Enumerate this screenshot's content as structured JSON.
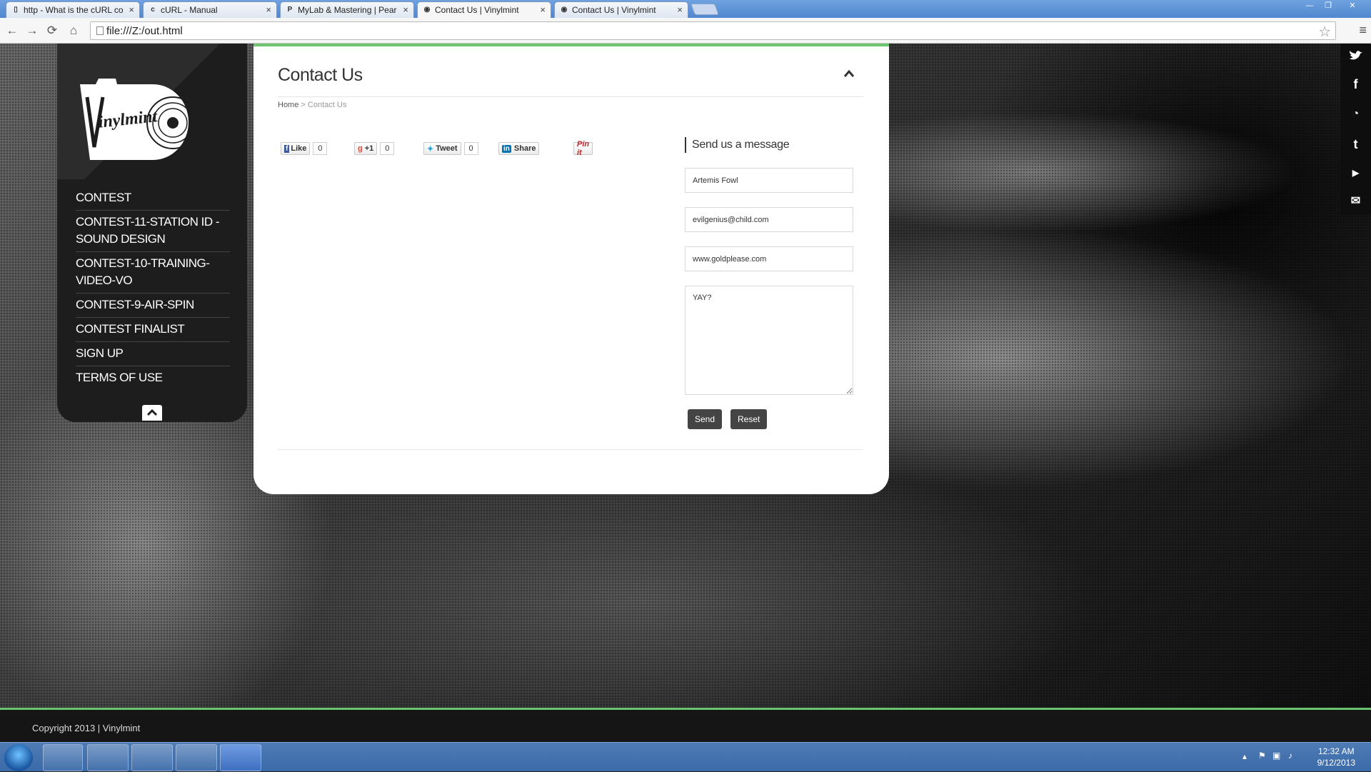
{
  "browser": {
    "tabs": [
      {
        "label": "http - What is the cURL co",
        "icon": "doc-icon"
      },
      {
        "label": "cURL - Manual",
        "icon": "curl-icon"
      },
      {
        "label": "MyLab & Mastering | Pear",
        "icon": "p-icon"
      },
      {
        "label": "Contact Us | Vinylmint",
        "icon": "vinylmint-icon",
        "active": true
      },
      {
        "label": "Contact Us | Vinylmint",
        "icon": "vinylmint-icon"
      }
    ],
    "url": "file:///Z:/out.html"
  },
  "sidebar": {
    "logo_text": "Vinylmint",
    "menu": [
      "CONTEST",
      "CONTEST-11-STATION ID - SOUND DESIGN",
      "CONTEST-10-TRAINING-VIDEO-VO",
      "CONTEST-9-AIR-SPIN",
      "CONTEST FINALIST",
      "SIGN UP",
      "TERMS OF USE"
    ]
  },
  "main": {
    "title": "Contact Us",
    "breadcrumb": {
      "home": "Home",
      "separator": ">",
      "current": "Contact Us"
    },
    "share": {
      "like_label": "Like",
      "like_count": "0",
      "gplus_label": "+1",
      "gplus_count": "0",
      "tweet_label": "Tweet",
      "tweet_count": "0",
      "share_label": "Share",
      "pin_label": "Pin it"
    },
    "form": {
      "heading": "Send us a message",
      "name_value": "Artemis Fowl",
      "email_value": "evilgenius@child.com",
      "website_value": "www.goldplease.com",
      "message_value": "YAY?",
      "send_label": "Send",
      "reset_label": "Reset"
    }
  },
  "social": [
    "twitter-icon",
    "facebook-icon",
    "rss-icon",
    "tumblr-icon",
    "youtube-icon",
    "mail-icon"
  ],
  "footer": {
    "copyright": "Copyright 2013 | Vinylmint"
  },
  "taskbar": {
    "time": "12:32 AM",
    "date": "9/12/2013"
  },
  "colors": {
    "accent": "#6cc56c",
    "sidebar_bg": "#1d1d1d",
    "button_bg": "#444444"
  }
}
